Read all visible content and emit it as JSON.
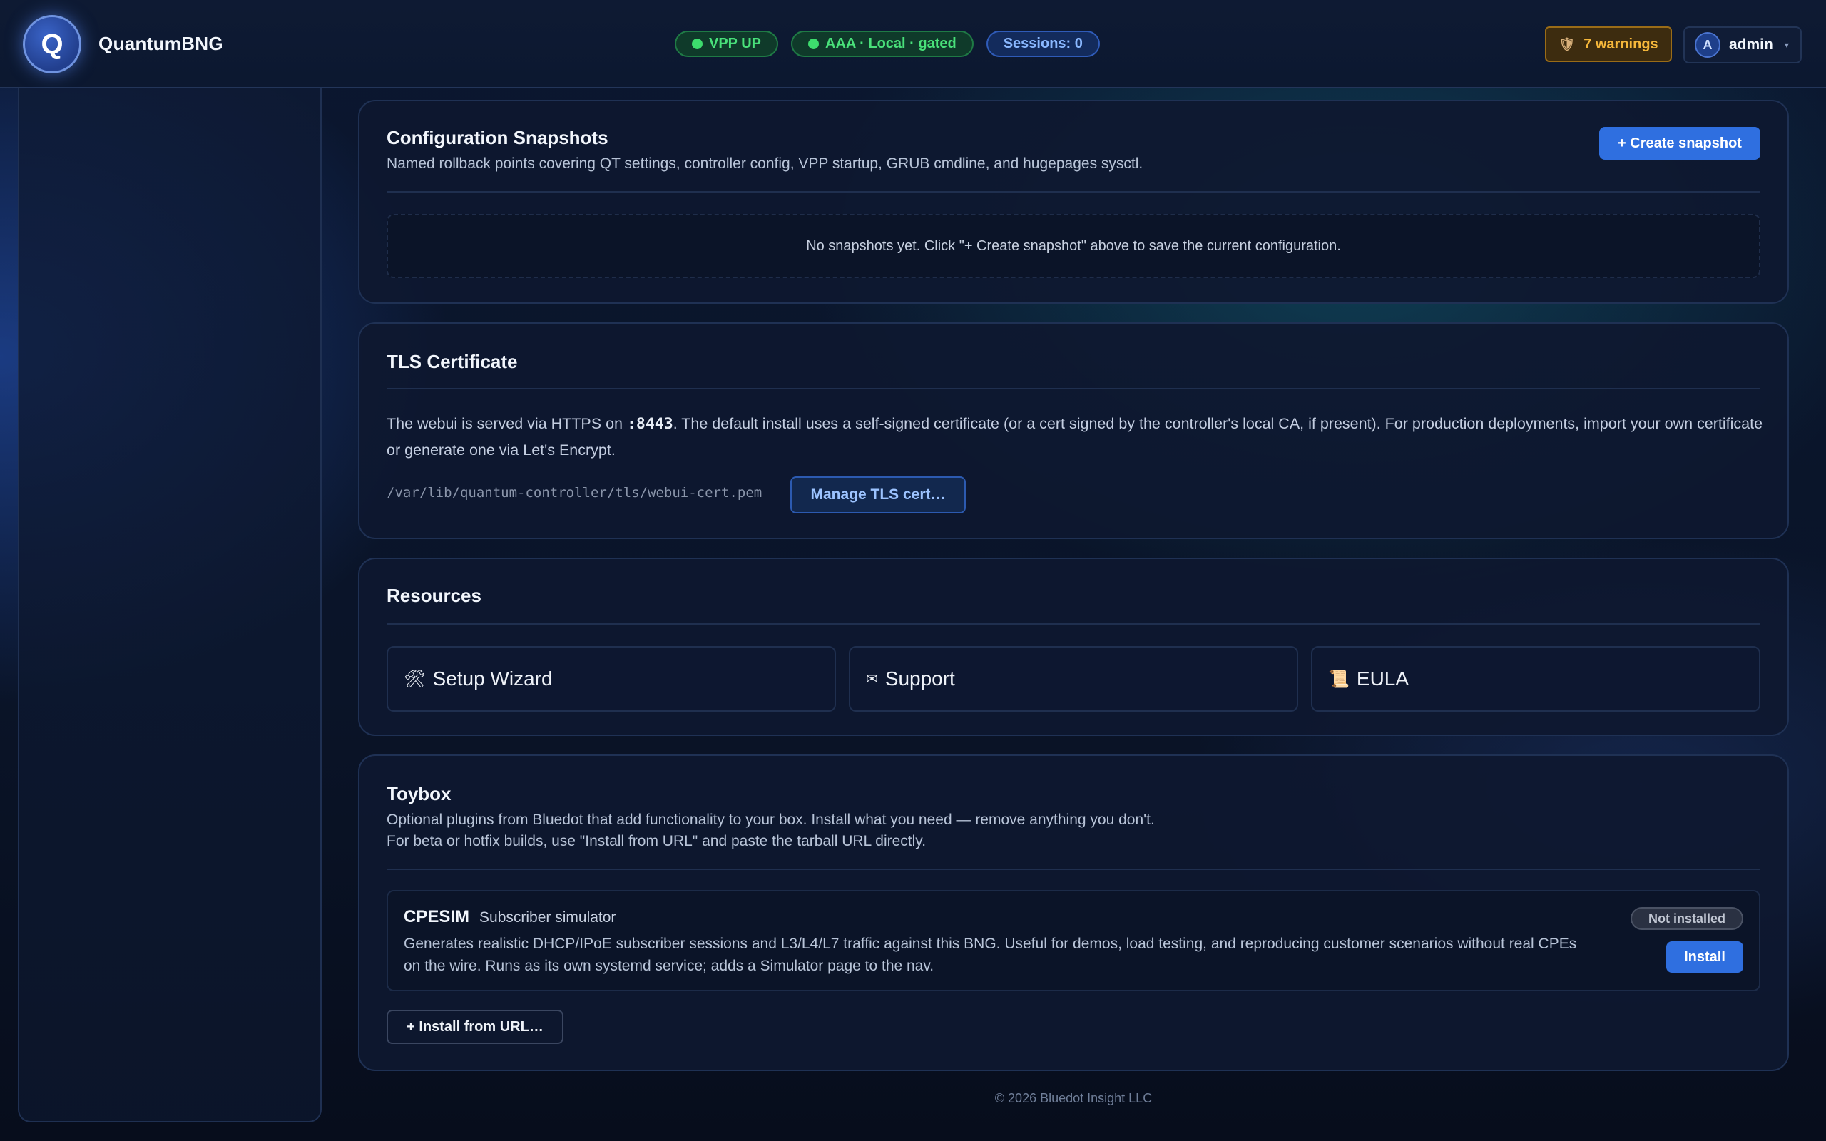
{
  "header": {
    "logo_letter": "Q",
    "brand": "QuantumBNG",
    "status_pills": [
      {
        "label": "VPP UP",
        "tone": "green"
      },
      {
        "label": "AAA · Local · gated",
        "tone": "green"
      },
      {
        "label": "Sessions: 0",
        "tone": "blue"
      }
    ],
    "warnings_label": "7 warnings",
    "user_initial": "A",
    "user_name": "admin"
  },
  "snapshots": {
    "title": "Configuration Snapshots",
    "description": "Named rollback points covering QT settings, controller config, VPP startup, GRUB cmdline, and hugepages sysctl.",
    "create_button": "+ Create snapshot",
    "empty_text": "No snapshots yet. Click \"+ Create snapshot\" above to save the current configuration."
  },
  "tls": {
    "title": "TLS Certificate",
    "desc_part1": "The webui is served via HTTPS on ",
    "port": ":8443",
    "desc_part2": ". The default install uses a self-signed certificate (or a cert signed by the controller's local CA, if present). For production deployments, import your own certificate or generate one via Let's Encrypt.",
    "cert_path": "/var/lib/quantum-controller/tls/webui-cert.pem",
    "manage_button": "Manage TLS cert…"
  },
  "resources": {
    "title": "Resources",
    "items": [
      {
        "icon": "🛠",
        "label": "Setup Wizard"
      },
      {
        "icon": "✉",
        "label": "Support"
      },
      {
        "icon": "📜",
        "label": "EULA"
      }
    ]
  },
  "toybox": {
    "title": "Toybox",
    "desc_line1": "Optional plugins from Bluedot that add functionality to your box. Install what you need — remove anything you don't.",
    "desc_line2": "For beta or hotfix builds, use \"Install from URL\" and paste the tarball URL directly.",
    "plugin": {
      "name": "CPESIM",
      "subtitle": "Subscriber simulator",
      "description": "Generates realistic DHCP/IPoE subscriber sessions and L3/L4/L7 traffic against this BNG. Useful for demos, load testing, and reproducing customer scenarios without real CPEs on the wire. Runs as its own systemd service; adds a Simulator page to the nav.",
      "status": "Not installed",
      "install_button": "Install"
    },
    "install_url_button": "+ Install from URL…"
  },
  "footer": {
    "copyright": "© 2026 Bluedot Insight LLC"
  },
  "colors": {
    "accent": "#2f6fe0",
    "status_green": "#49e07a",
    "warning": "#f5b73a"
  }
}
